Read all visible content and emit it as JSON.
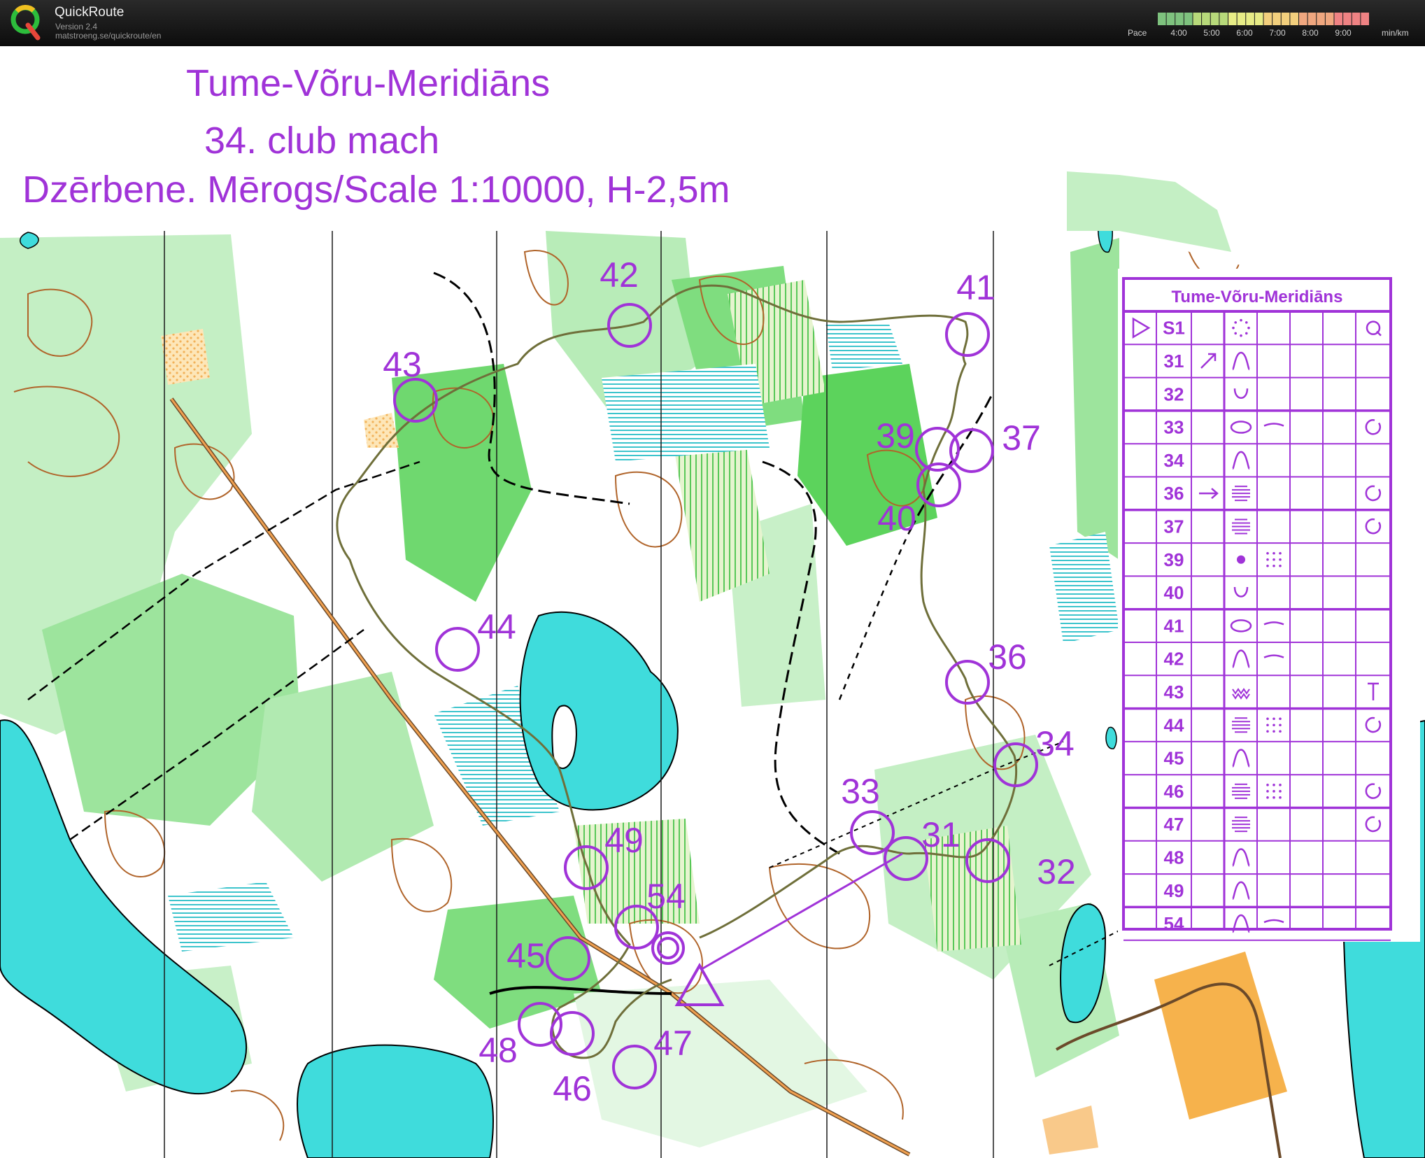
{
  "app": {
    "title": "QuickRoute",
    "version": "Version 2.4",
    "url": "matstroeng.se/quickroute/en",
    "pace": {
      "label": "Pace",
      "ticks": [
        "4:00",
        "5:00",
        "6:00",
        "7:00",
        "8:00",
        "9:00"
      ],
      "unit": "min/km",
      "colors": [
        "#7ec27e",
        "#b7d97a",
        "#e7ec86",
        "#f2cf7d",
        "#f0a77f",
        "#ef8283"
      ]
    }
  },
  "map": {
    "title": "Tume-Võru-Meridiāns",
    "subtitle": "34. club mach",
    "scale_line": "Dzērbene. Mērogs/Scale 1:10000, H-2,5m",
    "colors": {
      "course": "#a033d8",
      "water": "#3fdcdc",
      "forest": "#4ccd4c",
      "open": "#fbfbfb",
      "contour": "#b0642a",
      "route": "#6f6f3a"
    },
    "controls": [
      {
        "code": "S1",
        "label": ""
      },
      {
        "code": "31",
        "label": "31"
      },
      {
        "code": "32",
        "label": "32"
      },
      {
        "code": "33",
        "label": "33"
      },
      {
        "code": "34",
        "label": "34"
      },
      {
        "code": "36",
        "label": "36"
      },
      {
        "code": "37",
        "label": "37"
      },
      {
        "code": "39",
        "label": "39"
      },
      {
        "code": "40",
        "label": "40"
      },
      {
        "code": "41",
        "label": "41"
      },
      {
        "code": "42",
        "label": "42"
      },
      {
        "code": "43",
        "label": "43"
      },
      {
        "code": "44",
        "label": "44"
      },
      {
        "code": "45",
        "label": "45"
      },
      {
        "code": "46",
        "label": "46"
      },
      {
        "code": "47",
        "label": "47"
      },
      {
        "code": "48",
        "label": "48"
      },
      {
        "code": "49",
        "label": "49"
      },
      {
        "code": "54",
        "label": "54"
      }
    ]
  },
  "descriptions": {
    "title": "Tume-Võru-Meridiāns",
    "rows": [
      {
        "code": "S1",
        "dir": "",
        "feature": "depression-dotted",
        "appearance": "",
        "position": "open-end"
      },
      {
        "code": "31",
        "dir": "ne-arrow",
        "feature": "knoll",
        "appearance": "",
        "position": ""
      },
      {
        "code": "32",
        "dir": "",
        "feature": "small-depression",
        "appearance": "",
        "position": ""
      },
      {
        "code": "33",
        "dir": "",
        "feature": "elongated-hill",
        "appearance": "saddle",
        "position": "part-circle"
      },
      {
        "code": "34",
        "dir": "",
        "feature": "knoll",
        "appearance": "",
        "position": ""
      },
      {
        "code": "36",
        "dir": "east-arrow",
        "feature": "marsh",
        "appearance": "",
        "position": "part-circle"
      },
      {
        "code": "37",
        "dir": "",
        "feature": "marsh",
        "appearance": "",
        "position": "part-circle"
      },
      {
        "code": "39",
        "dir": "",
        "feature": "boulder",
        "appearance": "rocky-dots",
        "position": ""
      },
      {
        "code": "40",
        "dir": "",
        "feature": "small-depression",
        "appearance": "",
        "position": ""
      },
      {
        "code": "41",
        "dir": "",
        "feature": "elongated-hill",
        "appearance": "saddle",
        "position": ""
      },
      {
        "code": "42",
        "dir": "",
        "feature": "knoll",
        "appearance": "saddle",
        "position": ""
      },
      {
        "code": "43",
        "dir": "",
        "feature": "thicket",
        "appearance": "",
        "position": "t-foot"
      },
      {
        "code": "44",
        "dir": "",
        "feature": "marsh",
        "appearance": "rocky-dots",
        "position": "part-circle"
      },
      {
        "code": "45",
        "dir": "",
        "feature": "knoll",
        "appearance": "",
        "position": ""
      },
      {
        "code": "46",
        "dir": "",
        "feature": "marsh",
        "appearance": "rocky-dots",
        "position": "part-circle"
      },
      {
        "code": "47",
        "dir": "",
        "feature": "marsh",
        "appearance": "",
        "position": "part-circle"
      },
      {
        "code": "48",
        "dir": "",
        "feature": "knoll",
        "appearance": "",
        "position": ""
      },
      {
        "code": "49",
        "dir": "",
        "feature": "knoll",
        "appearance": "",
        "position": ""
      },
      {
        "code": "54",
        "dir": "",
        "feature": "knoll",
        "appearance": "saddle",
        "position": ""
      }
    ]
  }
}
